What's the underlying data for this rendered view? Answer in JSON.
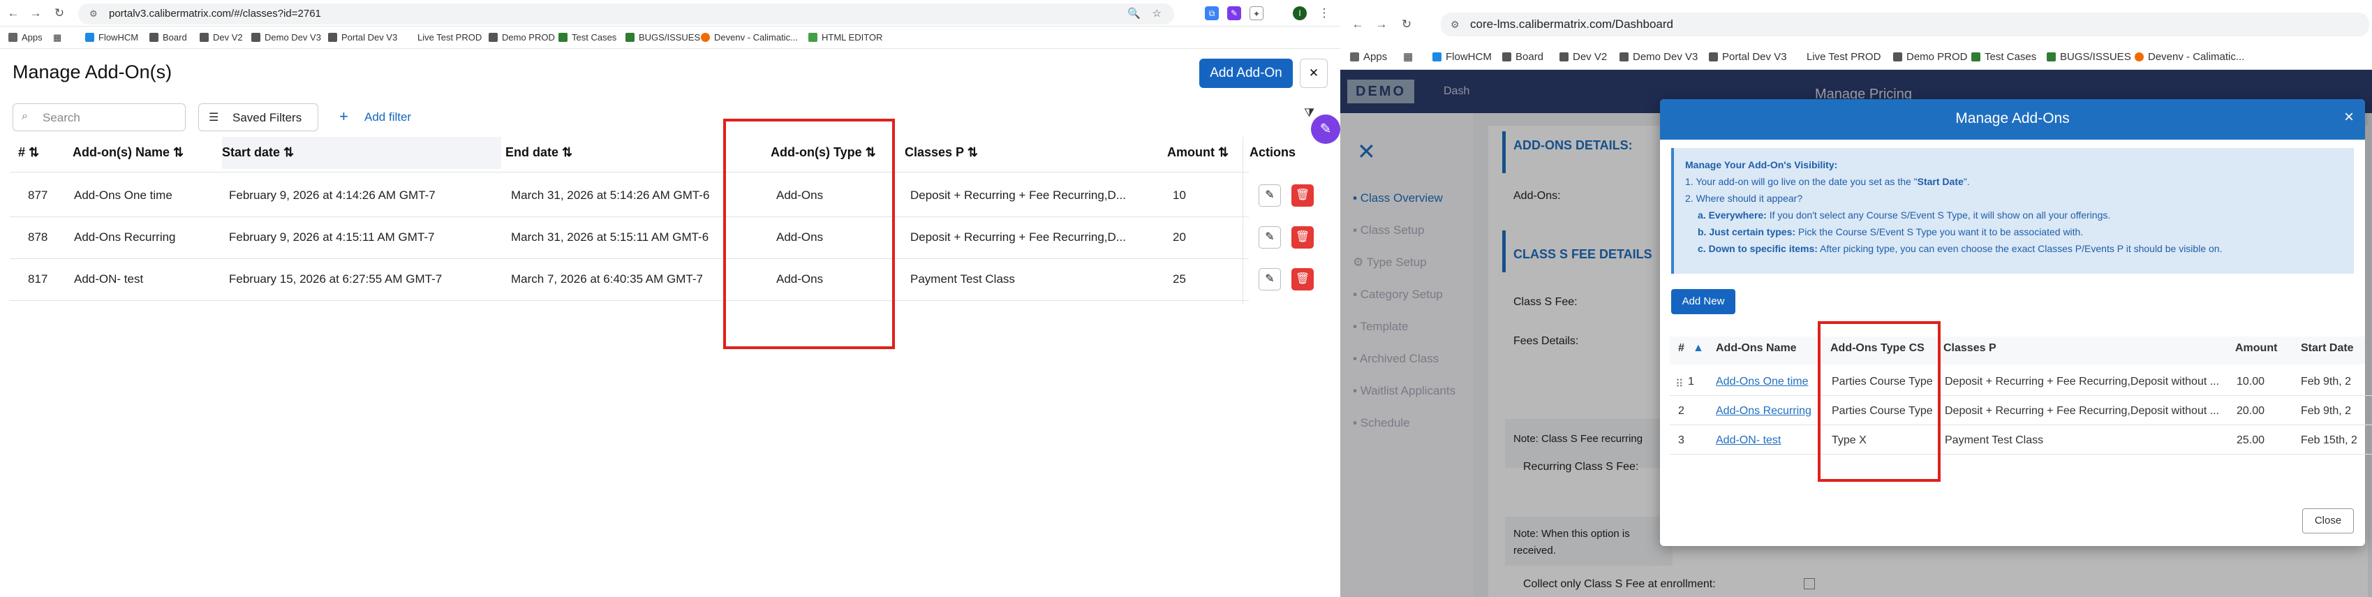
{
  "left": {
    "url": "portalv3.calibermatrix.com/#/classes?id=2761",
    "bookmarks": [
      "Apps",
      "FlowHCM",
      "Board",
      "Dev V2",
      "Demo Dev V3",
      "Portal Dev V3",
      "Live Test PROD",
      "Demo PROD",
      "Test Cases",
      "BUGS/ISSUES",
      "Devenv - Calimatic...",
      "HTML EDITOR"
    ],
    "page_title": "Manage Add-On(s)",
    "add_button": "Add Add-On",
    "close_glyph": "✕",
    "search_placeholder": "Search",
    "saved_filters": "Saved Filters",
    "add_filter": "Add filter",
    "columns": [
      "#",
      "Add-on(s) Name",
      "Start date",
      "End date",
      "Add-on(s) Type",
      "Classes P",
      "Amount",
      "Actions"
    ],
    "rows": [
      {
        "id": "877",
        "name": "Add-Ons One time",
        "start": "February 9, 2026 at 4:14:26 AM GMT-7",
        "end": "March 31, 2026 at 5:14:26 AM GMT-6",
        "type": "Add-Ons",
        "classes": "Deposit + Recurring + Fee Recurring,D...",
        "amount": "10"
      },
      {
        "id": "878",
        "name": "Add-Ons Recurring",
        "start": "February 9, 2026 at 4:15:11 AM GMT-7",
        "end": "March 31, 2026 at 5:15:11 AM GMT-6",
        "type": "Add-Ons",
        "classes": "Deposit + Recurring + Fee Recurring,D...",
        "amount": "20"
      },
      {
        "id": "817",
        "name": "Add-ON- test",
        "start": "February 15, 2026 at 6:27:55 AM GMT-7",
        "end": "March 7, 2026 at 6:40:35 AM GMT-7",
        "type": "Add-Ons",
        "classes": "Payment Test Class",
        "amount": "25"
      }
    ]
  },
  "right": {
    "url": "core-lms.calibermatrix.com/Dashboard",
    "bookmarks": [
      "Apps",
      "FlowHCM",
      "Board",
      "Dev V2",
      "Demo Dev V3",
      "Portal Dev V3",
      "Live Test PROD",
      "Demo PROD",
      "Test Cases",
      "BUGS/ISSUES",
      "Devenv - Calimatic..."
    ],
    "logo": "DEMO",
    "behind_title": "Manage Pricing",
    "behind_dash": "Dash",
    "sidebar": [
      "Class Overview",
      "Class Setup",
      "Type Setup",
      "Category Setup",
      "Template",
      "Archived Class",
      "Waitlist Applicants",
      "Schedule"
    ],
    "behind": {
      "addons_details": "ADD-ONS DETAILS:",
      "addons_label": "Add-Ons:",
      "fee_details": "CLASS S FEE DETAILS",
      "class_fee": "Class S Fee:",
      "fees_details": "Fees Details:",
      "note1": "Note: Class S Fee recurring",
      "recurring_fee": "Recurring Class S Fee:",
      "note2": "Note: When this option is",
      "received": "received.",
      "collect": "Collect only Class S Fee at enrollment:"
    },
    "modal": {
      "title": "Manage Add-Ons",
      "info_title": "Manage Your Add-On's Visibility:",
      "info_1a": "1. Your add-on will go live on the date you set as the \"",
      "info_1b": "Start Date",
      "info_1c": "\".",
      "info_2": "2. Where should it appear?",
      "info_a_bold": "a. Everywhere:",
      "info_a": " If you don't select any Course S/Event S Type, it will show on all your offerings.",
      "info_b_bold": "b. Just certain types:",
      "info_b": " Pick the Course S/Event S Type you want it to be associated with.",
      "info_c_bold": "c. Down to specific items:",
      "info_c": " After picking type, you can even choose the exact Classes P/Events P it should be visible on.",
      "add_new": "Add New",
      "columns": [
        "#",
        "Add-Ons Name",
        "Add-Ons Type CS",
        "Classes P",
        "Amount",
        "Start Date"
      ],
      "rows": [
        {
          "n": "1",
          "name": "Add-Ons One time",
          "type": "Parties Course Type",
          "classes": "Deposit + Recurring + Fee Recurring,Deposit without ...",
          "amount": "10.00",
          "start": "Feb 9th, 2"
        },
        {
          "n": "2",
          "name": "Add-Ons Recurring",
          "type": "Parties Course Type",
          "classes": "Deposit + Recurring + Fee Recurring,Deposit without ...",
          "amount": "20.00",
          "start": "Feb 9th, 2"
        },
        {
          "n": "3",
          "name": "Add-ON- test",
          "type": "Type X",
          "classes": "Payment Test Class",
          "amount": "25.00",
          "start": "Feb 15th, 2"
        }
      ],
      "close_button": "Close",
      "close_x": "×"
    }
  }
}
